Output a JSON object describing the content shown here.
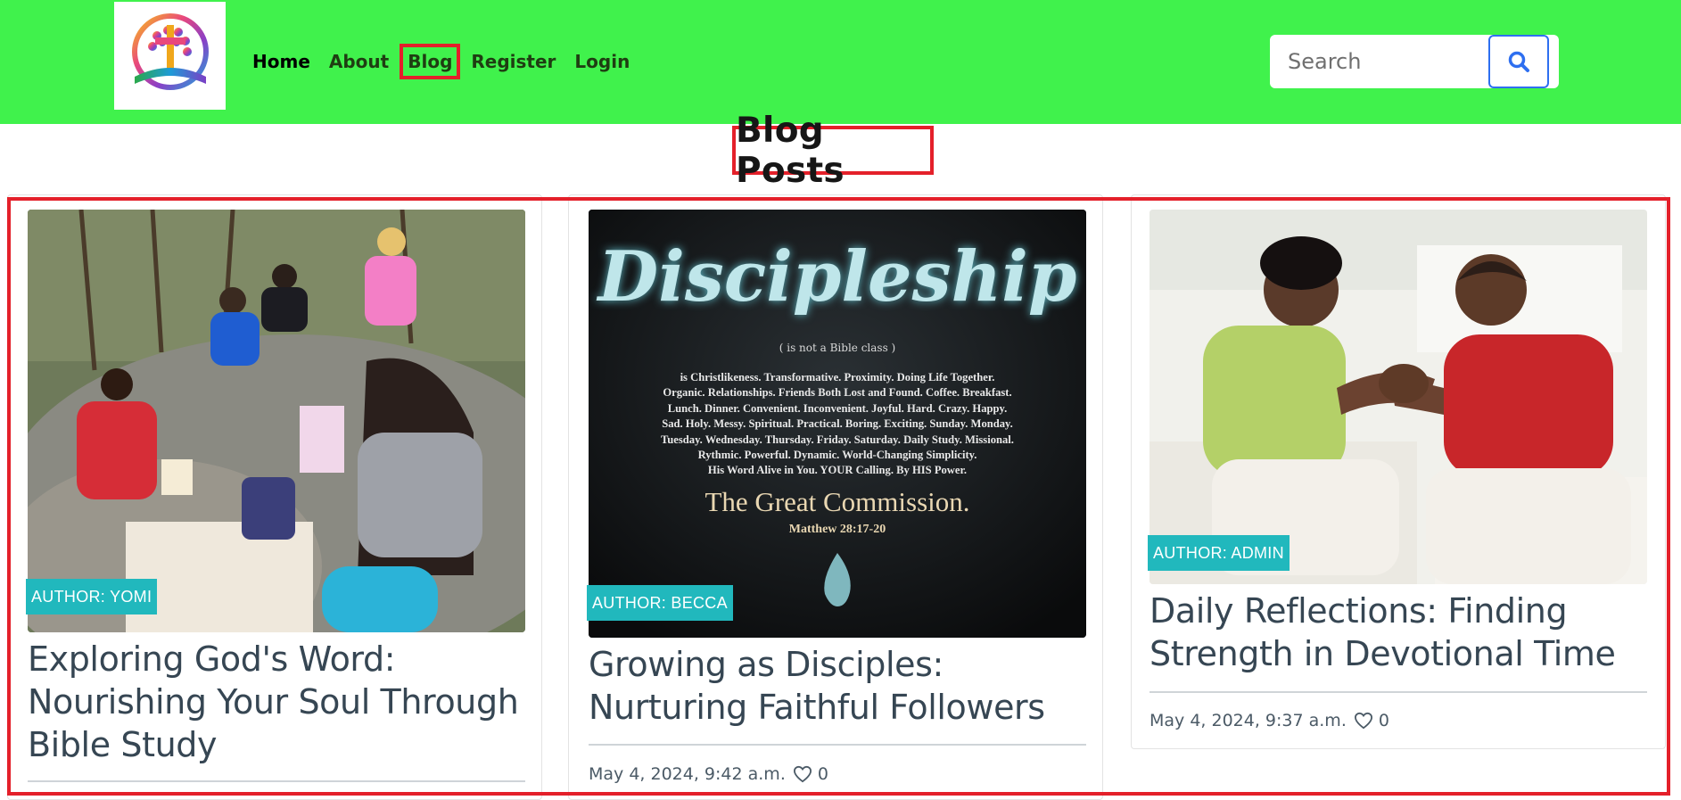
{
  "nav": {
    "links": [
      {
        "label": "Home"
      },
      {
        "label": "About"
      },
      {
        "label": "Blog"
      },
      {
        "label": "Register"
      },
      {
        "label": "Login"
      }
    ],
    "search": {
      "placeholder": "Search",
      "icon": "search-icon"
    },
    "colors": {
      "navbar": "#40f24c",
      "search_button_border": "#2e6ff0"
    }
  },
  "page": {
    "title": "Blog Posts"
  },
  "posts": [
    {
      "author": "AUTHOR: YOMI",
      "title": "Exploring God's Word: Nourishing Your Soul Through Bible Study",
      "date": "",
      "likes": ""
    },
    {
      "author": "AUTHOR: BECCA",
      "title": "Growing as Disciples: Nurturing Faithful Followers",
      "date": "May 4, 2024, 9:42 a.m.",
      "likes": "0",
      "image_text": {
        "word": "Discipleship",
        "sub": "( is not a Bible class )",
        "lines": [
          "is Christlikeness. Transformative. Proximity. Doing Life Together.",
          "Organic. Relationships. Friends Both Lost and Found. Coffee. Breakfast.",
          "Lunch. Dinner. Convenient. Inconvenient. Joyful. Hard. Crazy. Happy.",
          "Sad. Holy. Messy. Spiritual. Practical. Boring. Exciting. Sunday. Monday.",
          "Tuesday. Wednesday. Thursday. Friday. Saturday. Daily Study. Missional.",
          "Rythmic. Powerful. Dynamic. World-Changing Simplicity.",
          "His Word Alive in You. YOUR Calling. By HIS Power."
        ],
        "commission": "The Great Commission.",
        "verse": "Matthew 28:17-20"
      }
    },
    {
      "author": "AUTHOR: ADMIN",
      "title": "Daily Reflections: Finding Strength in Devotional Time",
      "date": "May 4, 2024, 9:37 a.m.",
      "likes": "0"
    }
  ],
  "colors": {
    "badge": "#21b8bd",
    "highlight": "#e4202a"
  }
}
